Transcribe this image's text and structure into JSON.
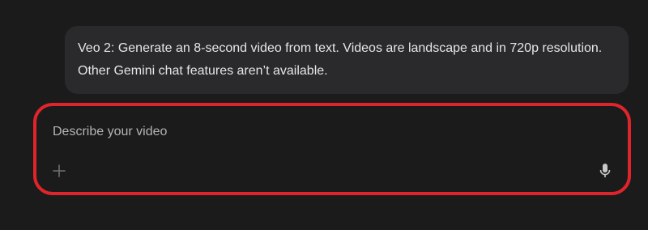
{
  "banner": {
    "line1": "Veo 2: Generate an 8-second video from text. Videos are landscape and in 720p resolution.",
    "line2": "Other Gemini chat features aren’t available."
  },
  "prompt": {
    "placeholder": "Describe your video",
    "value": "",
    "highlight_color": "#e0242b"
  },
  "icons": {
    "add": "plus-icon",
    "mic": "microphone-icon"
  }
}
